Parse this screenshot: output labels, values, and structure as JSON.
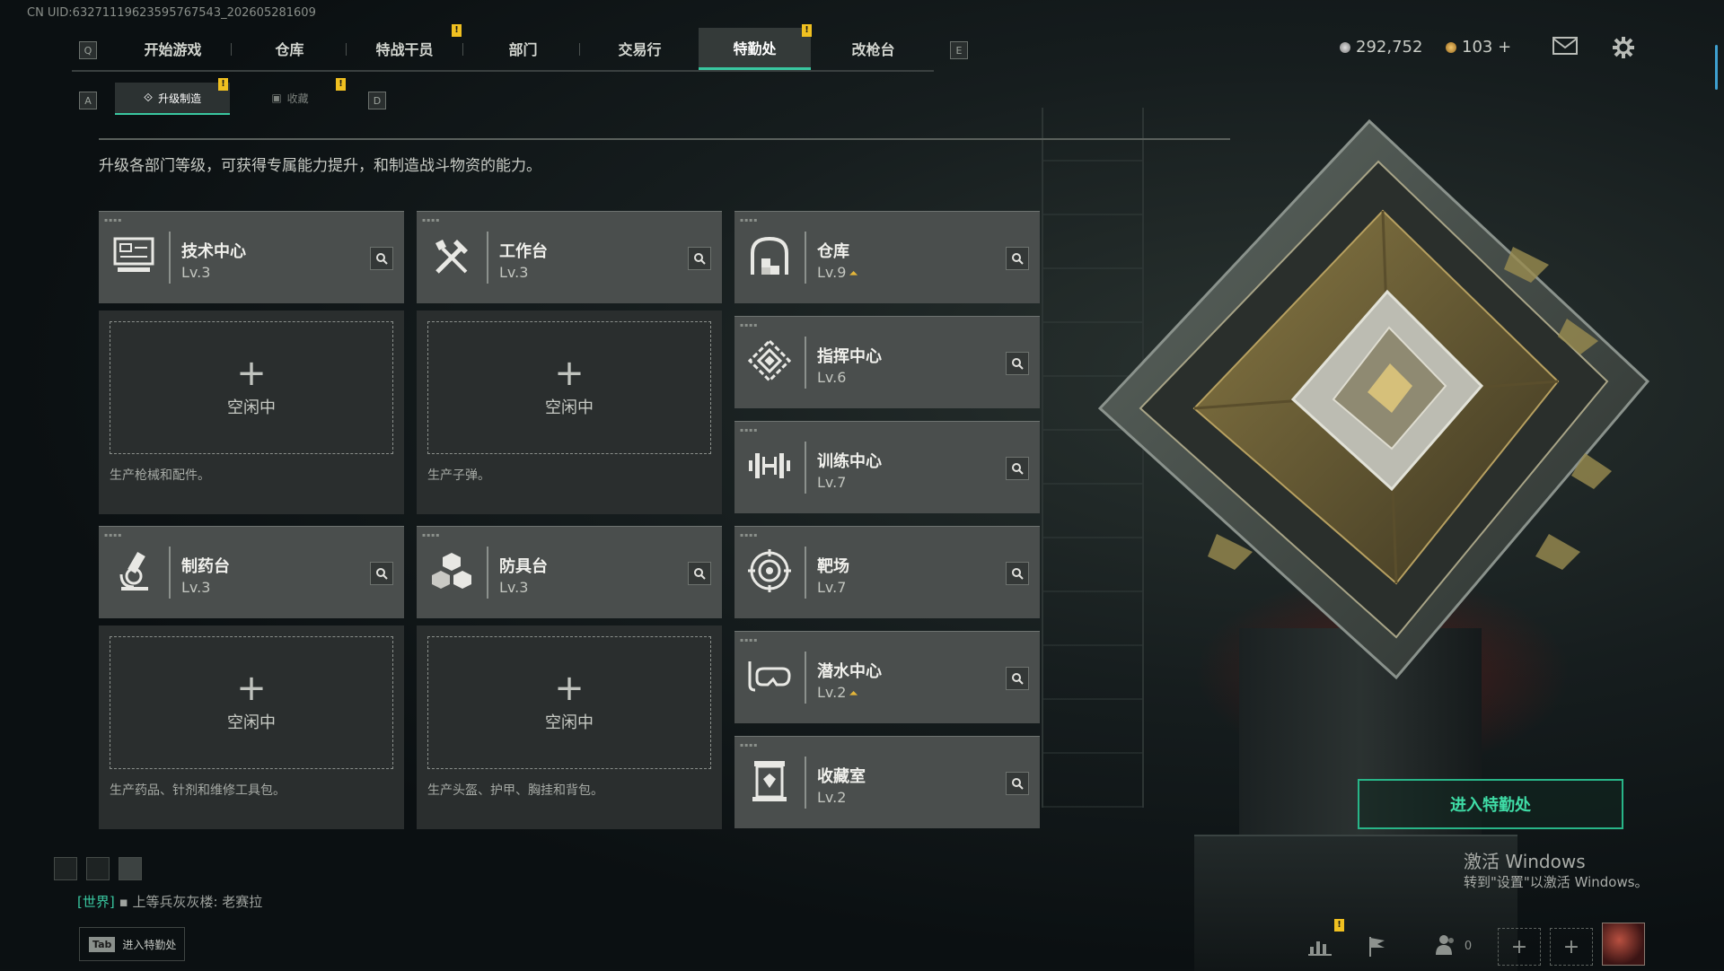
{
  "uid": "CN UID:632711196235957675​43_202605281609",
  "top_nav": {
    "key_left": "Q",
    "key_right": "E",
    "tabs": [
      {
        "label": "开始游戏",
        "active": false
      },
      {
        "label": "仓库",
        "active": false
      },
      {
        "label": "特战干员",
        "active": false,
        "alert": "!"
      },
      {
        "label": "部门",
        "active": false
      },
      {
        "label": "交易行",
        "active": false
      },
      {
        "label": "特勤处",
        "active": true,
        "alert": "!"
      },
      {
        "label": "改枪台",
        "active": false
      }
    ]
  },
  "currency": {
    "silver": "292,752",
    "gold": "103 +"
  },
  "header_icons": [
    "mail-icon",
    "gear-icon"
  ],
  "sub_nav": {
    "key_left": "A",
    "key_right": "D",
    "tabs": [
      {
        "label": "升级制造",
        "active": true,
        "icon": "upgrade-icon",
        "alert": "!"
      },
      {
        "label": "收藏",
        "active": false,
        "icon": "collection-icon",
        "alert": "!"
      }
    ]
  },
  "description": "升级各部门等级，可获得专属能力提升，和制造战斗物资的能力。",
  "production_stations": [
    {
      "name": "技术中心",
      "level": "Lv.3",
      "icon": "computer-icon",
      "slot_status": "空闲中",
      "slot_desc": "生产枪械和配件。"
    },
    {
      "name": "工作台",
      "level": "Lv.3",
      "icon": "tools-icon",
      "slot_status": "空闲中",
      "slot_desc": "生产子弹。"
    },
    {
      "name": "制药台",
      "level": "Lv.3",
      "icon": "microscope-icon",
      "slot_status": "空闲中",
      "slot_desc": "生产药品、针剂和维修工具包。"
    },
    {
      "name": "防具台",
      "level": "Lv.3",
      "icon": "armor-blocks-icon",
      "slot_status": "空闲中",
      "slot_desc": "生产头盔、护甲、胸挂和背包。"
    }
  ],
  "departments": [
    {
      "name": "仓库",
      "level": "Lv.9",
      "upgradable": true,
      "icon": "warehouse-icon"
    },
    {
      "name": "指挥中心",
      "level": "Lv.6",
      "upgradable": false,
      "icon": "command-center-icon"
    },
    {
      "name": "训练中心",
      "level": "Lv.7",
      "upgradable": false,
      "icon": "dumbbell-icon"
    },
    {
      "name": "靶场",
      "level": "Lv.7",
      "upgradable": false,
      "icon": "target-icon"
    },
    {
      "name": "潜水中心",
      "level": "Lv.2",
      "upgradable": true,
      "icon": "diving-mask-icon"
    },
    {
      "name": "收藏室",
      "level": "Lv.2",
      "upgradable": false,
      "icon": "display-case-icon"
    }
  ],
  "enter_button": "进入特勤处",
  "windows_watermark": {
    "line1": "激活 Windows",
    "line2": "转到\"设置\"以激活 Windows。"
  },
  "chat": {
    "channel": "[世界]",
    "message": "上等兵灰灰楼: 老赛拉"
  },
  "tab_hint": {
    "key": "Tab",
    "label": "进入特勤处"
  },
  "friends_count": "0",
  "colors": {
    "accent": "#39c7a0",
    "alert": "#f0c020",
    "upgrade_arrow": "#e4b63a"
  }
}
